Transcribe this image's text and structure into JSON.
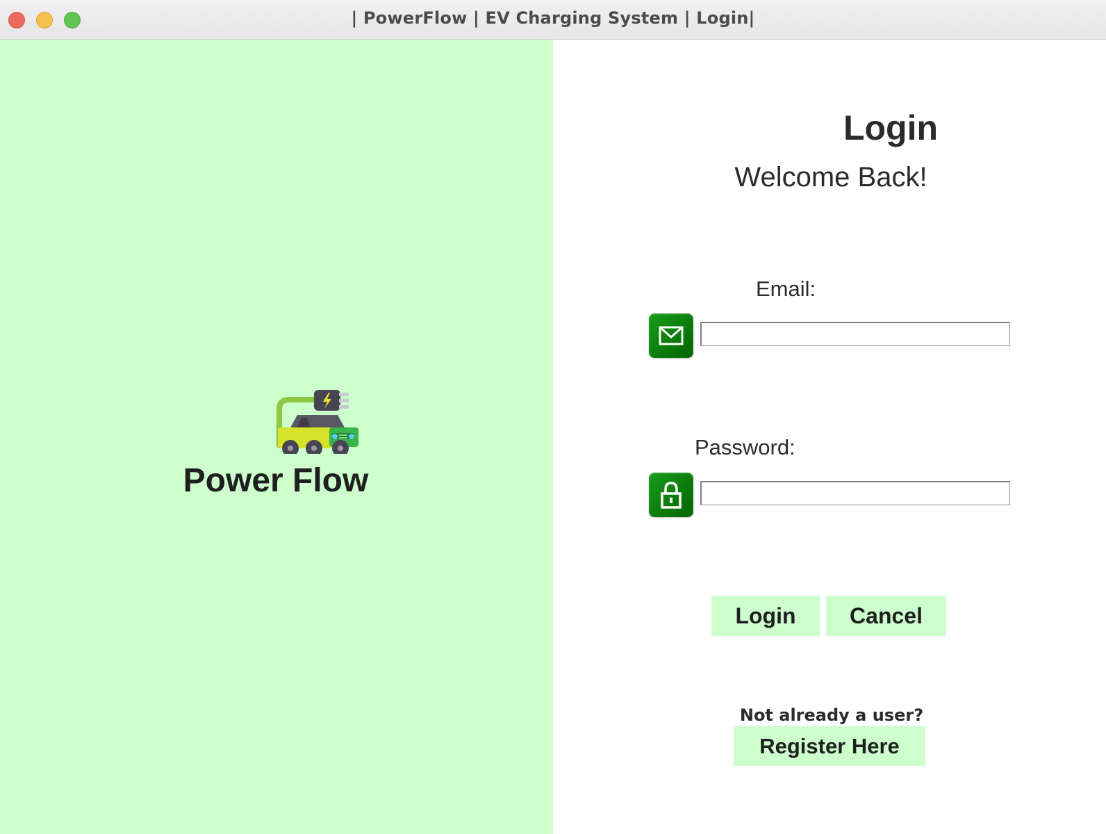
{
  "window": {
    "title": "| PowerFlow | EV Charging System | Login|"
  },
  "brand": {
    "name": "Power Flow",
    "logo_icon": "ev-car-charging-icon"
  },
  "form": {
    "heading": "Login",
    "subheading": "Welcome Back!",
    "email_label": "Email:",
    "email_value": "",
    "email_icon": "envelope-icon",
    "password_label": "Password:",
    "password_value": "",
    "password_icon": "lock-icon",
    "login_button": "Login",
    "cancel_button": "Cancel",
    "register_prompt": "Not already a user?",
    "register_button": "Register Here"
  },
  "colors": {
    "panel_green": "#ccffcc",
    "icon_green": "#0b7a0b",
    "text": "#2b2b2b"
  }
}
